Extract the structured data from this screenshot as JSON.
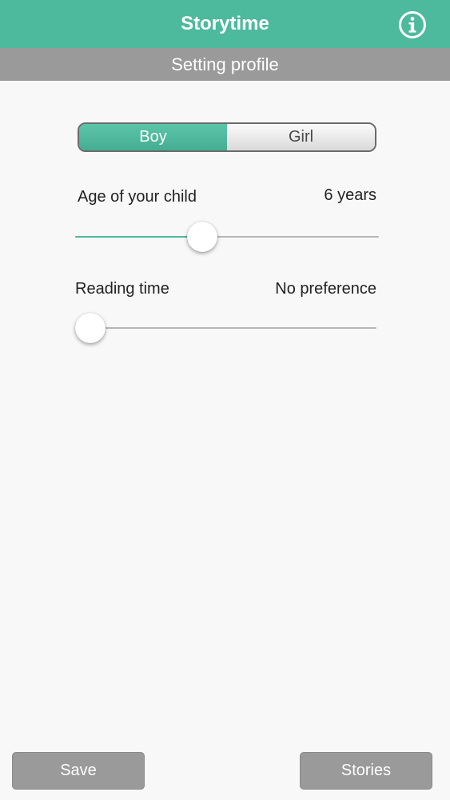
{
  "header": {
    "title": "Storytime",
    "info_icon": "info-circle-icon",
    "accent_color": "#4db99d"
  },
  "subheader": {
    "title": "Setting profile",
    "color": "#9a9a9a"
  },
  "gender_selector": {
    "options": [
      "Boy",
      "Girl"
    ],
    "selected": "Boy"
  },
  "age": {
    "label": "Age of your child",
    "value": "6 years",
    "slider_fraction": 0.41
  },
  "reading_time": {
    "label": "Reading time",
    "value": "No preference",
    "slider_fraction": 0.0
  },
  "footer": {
    "save_label": "Save",
    "stories_label": "Stories"
  }
}
